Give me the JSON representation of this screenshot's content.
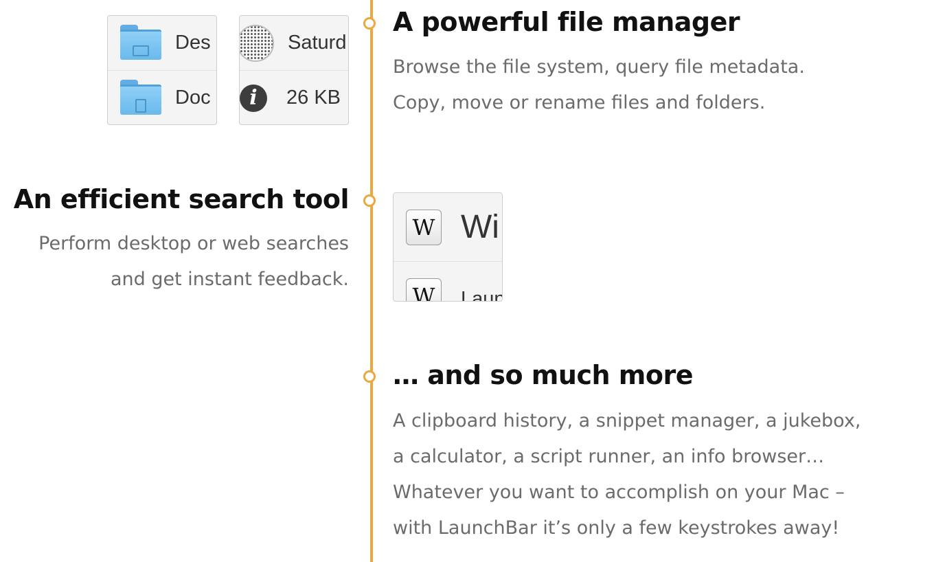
{
  "features": [
    {
      "title": "A powerful file manager",
      "description_lines": [
        "Browse the file system, query file metadata.",
        "Copy, move or rename files and folders."
      ],
      "panels": [
        {
          "rows": [
            {
              "icon": "folder-desktop-icon",
              "text": "Des"
            },
            {
              "icon": "folder-documents-icon",
              "text": "Doc"
            }
          ]
        },
        {
          "rows": [
            {
              "icon": "dotted-disk-icon",
              "text": "Saturd"
            },
            {
              "icon": "info-icon",
              "glyph": "i",
              "text": "26 KB"
            }
          ]
        }
      ]
    },
    {
      "title": "An efficient search tool",
      "description_lines": [
        "Perform desktop or web searches",
        "and get instant feedback."
      ],
      "panel": {
        "rows": [
          {
            "icon": "wikipedia-icon",
            "glyph": "W",
            "text": "Wi"
          },
          {
            "icon": "wikipedia-icon",
            "glyph": "W",
            "text": "Laun"
          }
        ]
      }
    },
    {
      "title": "… and so much more",
      "description_lines": [
        "A clipboard history, a snippet manager, a jukebox,",
        "a calculator, a script runner, an info browser…",
        "Whatever you want to accomplish on your Mac –",
        "with LaunchBar it’s only a few keystrokes away!"
      ]
    }
  ],
  "colors": {
    "accent": "#EDA73C",
    "title": "#111111",
    "body_text": "#6b6b6b"
  }
}
